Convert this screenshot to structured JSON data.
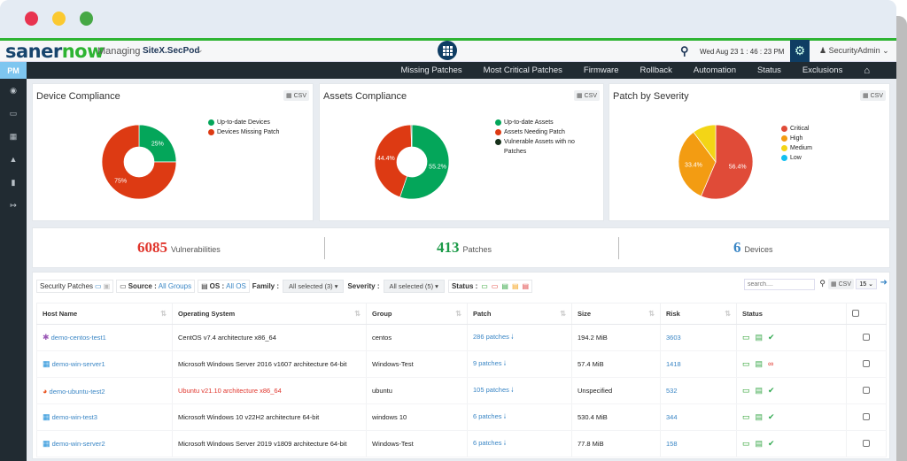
{
  "header": {
    "brand_part1": "saner",
    "brand_part2": "now",
    "managing_label": "Managing",
    "site_name": "SiteX.SecPod",
    "datetime": "Wed Aug 23  1 : 46 : 23 PM",
    "user": "SecurityAdmin"
  },
  "module_badge": "PM",
  "nav": [
    "Missing Patches",
    "Most Critical Patches",
    "Firmware",
    "Rollback",
    "Automation",
    "Status",
    "Exclusions"
  ],
  "sidebar_icons": [
    "eye-icon",
    "monitor-icon",
    "calculator-icon",
    "warning-icon",
    "eraser-icon",
    "logout-icon"
  ],
  "csv_label": "CSV",
  "chart_data": [
    {
      "type": "pie",
      "title": "Device Compliance",
      "donut": true,
      "categories": [
        "Up-to-date Devices",
        "Devices Missing Patch"
      ],
      "values": [
        25,
        75
      ],
      "labels": [
        "25%",
        "75%"
      ],
      "colors": [
        "#04a65a",
        "#dd3a13"
      ],
      "legend": "top-right"
    },
    {
      "type": "pie",
      "title": "Assets Compliance",
      "donut": true,
      "categories": [
        "Up-to-date Assets",
        "Assets Needing Patch",
        "Vulnerable Assets with no Patches"
      ],
      "values": [
        55.2,
        44.4,
        0.4
      ],
      "labels": [
        "55.2%",
        "44.4%",
        ""
      ],
      "colors": [
        "#04a65a",
        "#dd3a13",
        "#17301a"
      ],
      "legend": "top-right"
    },
    {
      "type": "pie",
      "title": "Patch by Severity",
      "donut": false,
      "categories": [
        "Critical",
        "High",
        "Medium",
        "Low"
      ],
      "values": [
        56.4,
        33.4,
        10.2,
        0
      ],
      "labels": [
        "56.4%",
        "33.4%",
        "",
        ""
      ],
      "colors": [
        "#e04b38",
        "#f39c12",
        "#f3d516",
        "#14c0f0"
      ],
      "legend": "top-right"
    }
  ],
  "stats": [
    {
      "value": "6085",
      "label": "Vulnerabilities",
      "color": "#e0352c"
    },
    {
      "value": "413",
      "label": "Patches",
      "color": "#1c9a48"
    },
    {
      "value": "6",
      "label": "Devices",
      "color": "#3a86c5"
    }
  ],
  "filters": {
    "title": "Security Patches",
    "source_label": "Source :",
    "source_value": "All Groups",
    "os_label": "OS :",
    "os_value": "All OS",
    "family_label": "Family :",
    "family_value": "All selected (3) ▾",
    "severity_label": "Severity :",
    "severity_value": "All selected (5) ▾",
    "status_label": "Status :",
    "search_placeholder": "search....",
    "page_size": "15"
  },
  "table": {
    "columns": [
      "Host Name",
      "Operating System",
      "Group",
      "Patch",
      "Size",
      "Risk",
      "Status"
    ],
    "rows": [
      {
        "host": "demo-centos-test1",
        "os_icon": "centos",
        "os": "CentOS v7.4 architecture x86_64",
        "os_warn": false,
        "group": "centos",
        "patch": "286 patches",
        "size": "194.2 MiB",
        "risk": "3603",
        "state": "ok"
      },
      {
        "host": "demo-win-server1",
        "os_icon": "windows",
        "os": "Microsoft Windows Server 2016 v1607 architecture 64-bit",
        "os_warn": false,
        "group": "Windows-Test",
        "patch": "9 patches",
        "size": "57.4 MiB",
        "risk": "1418",
        "state": "broken"
      },
      {
        "host": "demo-ubuntu-test2",
        "os_icon": "ubuntu",
        "os": "Ubuntu v21.10 architecture x86_64",
        "os_warn": true,
        "group": "ubuntu",
        "patch": "105 patches",
        "size": "Unspecified",
        "risk": "532",
        "state": "ok"
      },
      {
        "host": "demo-win-test3",
        "os_icon": "windows",
        "os": "Microsoft Windows 10 v22H2 architecture 64-bit",
        "os_warn": false,
        "group": "windows 10",
        "patch": "6 patches",
        "size": "530.4 MiB",
        "risk": "344",
        "state": "ok"
      },
      {
        "host": "demo-win-server2",
        "os_icon": "windows",
        "os": "Microsoft Windows Server 2019 v1809 architecture 64-bit",
        "os_warn": false,
        "group": "Windows-Test",
        "patch": "6 patches",
        "size": "77.8 MiB",
        "risk": "158",
        "state": "ok"
      }
    ]
  }
}
